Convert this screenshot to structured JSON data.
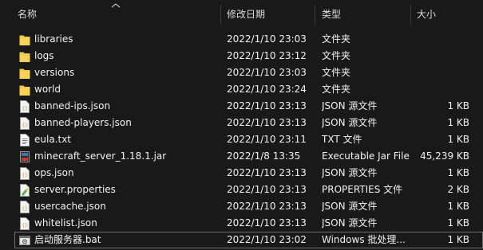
{
  "columns": {
    "name": "名称",
    "modified": "修改日期",
    "type": "类型",
    "size": "大小"
  },
  "files": [
    {
      "name": "libraries",
      "modified": "2022/1/10 23:03",
      "type": "文件夹",
      "size": "",
      "icon": "folder-icon"
    },
    {
      "name": "logs",
      "modified": "2022/1/10 23:12",
      "type": "文件夹",
      "size": "",
      "icon": "folder-icon"
    },
    {
      "name": "versions",
      "modified": "2022/1/10 23:03",
      "type": "文件夹",
      "size": "",
      "icon": "folder-icon"
    },
    {
      "name": "world",
      "modified": "2022/1/10 23:24",
      "type": "文件夹",
      "size": "",
      "icon": "folder-icon"
    },
    {
      "name": "banned-ips.json",
      "modified": "2022/1/10 23:13",
      "type": "JSON 源文件",
      "size": "1 KB",
      "icon": "json-file-icon"
    },
    {
      "name": "banned-players.json",
      "modified": "2022/1/10 23:13",
      "type": "JSON 源文件",
      "size": "1 KB",
      "icon": "json-file-icon"
    },
    {
      "name": "eula.txt",
      "modified": "2022/1/10 23:11",
      "type": "TXT 文件",
      "size": "1 KB",
      "icon": "text-file-icon"
    },
    {
      "name": "minecraft_server_1.18.1.jar",
      "modified": "2022/1/8 13:35",
      "type": "Executable Jar File",
      "size": "45,239 KB",
      "icon": "jar-file-icon"
    },
    {
      "name": "ops.json",
      "modified": "2022/1/10 23:13",
      "type": "JSON 源文件",
      "size": "1 KB",
      "icon": "json-file-icon"
    },
    {
      "name": "server.properties",
      "modified": "2022/1/10 23:13",
      "type": "PROPERTIES 文件",
      "size": "2 KB",
      "icon": "properties-file-icon"
    },
    {
      "name": "usercache.json",
      "modified": "2022/1/10 23:13",
      "type": "JSON 源文件",
      "size": "1 KB",
      "icon": "json-file-icon"
    },
    {
      "name": "whitelist.json",
      "modified": "2022/1/10 23:13",
      "type": "JSON 源文件",
      "size": "1 KB",
      "icon": "json-file-icon"
    },
    {
      "name": "启动服务器.bat",
      "modified": "2022/1/10 23:02",
      "type": "Windows 批处理...",
      "size": "1 KB",
      "icon": "batch-file-icon"
    }
  ],
  "colors": {
    "background": "#191919",
    "folder": "#f3c646",
    "json": "#e8b93a",
    "focus_outline": "#6f6f6f"
  }
}
